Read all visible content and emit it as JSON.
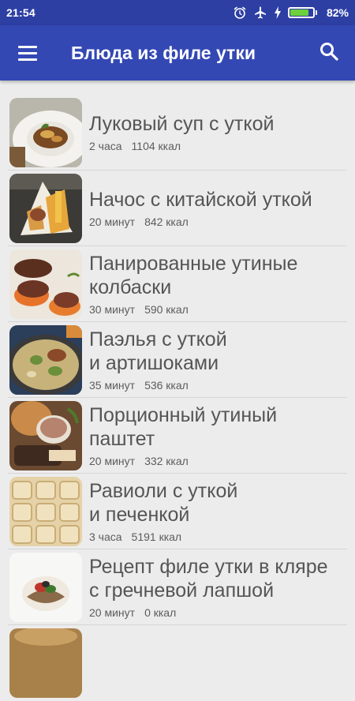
{
  "status_bar": {
    "time": "21:54",
    "icons": [
      "alarm-clock-icon",
      "airplane-mode-icon",
      "charging-bolt-icon",
      "battery-icon"
    ],
    "battery_percent": "82%",
    "battery_level": 0.82,
    "battery_color": "#6cd13c"
  },
  "app_bar": {
    "title": "Блюда из филе утки",
    "menu_icon": "hamburger-menu-icon",
    "search_icon": "search-icon",
    "color": "#3448b4"
  },
  "recipes": [
    {
      "title_lines": [
        "Луковый суп с уткой"
      ],
      "time": "2 часа",
      "kcal": "1104 ккал"
    },
    {
      "title_lines": [
        "Начос с китайской уткой"
      ],
      "time": "20 минут",
      "kcal": "842 ккал"
    },
    {
      "title_lines": [
        "Панированные утиные",
        "колбаски"
      ],
      "time": "30 минут",
      "kcal": "590 ккал"
    },
    {
      "title_lines": [
        "Паэлья с уткой",
        "и артишоками"
      ],
      "time": "35 минут",
      "kcal": "536 ккал"
    },
    {
      "title_lines": [
        "Порционный утиный",
        "паштет"
      ],
      "time": "20 минут",
      "kcal": "332 ккал"
    },
    {
      "title_lines": [
        "Равиоли с уткой",
        "и печенкой"
      ],
      "time": "3 часа",
      "kcal": "5191 ккал"
    },
    {
      "title_lines": [
        "Рецепт филе утки в кляре",
        "с гречневой лапшой"
      ],
      "time": "20 минут",
      "kcal": "0 ккал"
    }
  ]
}
